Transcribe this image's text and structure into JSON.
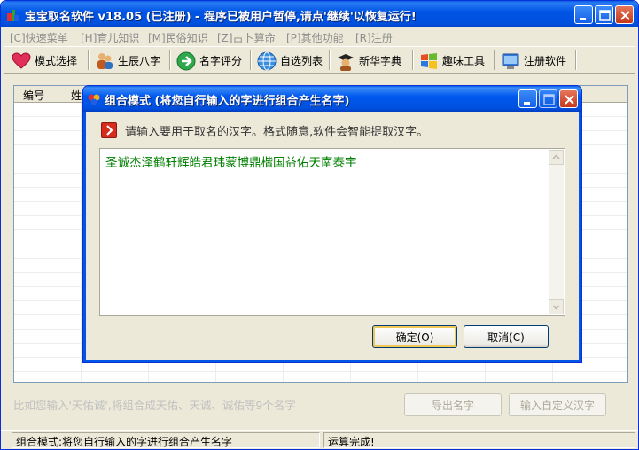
{
  "main_window": {
    "title": "宝宝取名软件 v18.05 (已注册) - 程序已被用户暂停,请点'继续'以恢复运行!"
  },
  "menu": [
    "[C]快速菜单",
    "[H]育儿知识",
    "[M]民俗知识",
    "[Z]占卜算命",
    "[P]其他功能",
    "[R]注册"
  ],
  "toolbar": [
    {
      "label": "模式选择",
      "icon": "heart-icon"
    },
    {
      "label": "生辰八字",
      "icon": "people-icon"
    },
    {
      "label": "名字评分",
      "icon": "arrow-right-icon"
    },
    {
      "label": "自选列表",
      "icon": "globe-icon"
    },
    {
      "label": "新华字典",
      "icon": "scholar-icon"
    },
    {
      "label": "趣味工具",
      "icon": "windows-icon"
    },
    {
      "label": "注册软件",
      "icon": "monitor-icon"
    }
  ],
  "grid": {
    "columns": [
      "编号",
      "姓"
    ]
  },
  "hint_text": "比如您输入'天佑诚',将组合成天佑、天诚、诚佑等9个名字",
  "bottom_buttons": {
    "export": "导出名字",
    "custom": "输入自定义汉字"
  },
  "status": {
    "left": "组合模式:将您自行输入的字进行组合产生名字",
    "right": "运算完成!"
  },
  "dialog": {
    "title": "组合模式 (将您自行输入的字进行组合产生名字)",
    "prompt": "请输入要用于取名的汉字。格式随意,软件会智能提取汉字。",
    "input_value": "圣诚杰泽鹤轩辉皓君玮蒙博鼎楷国益佑天南泰宇",
    "ok_label": "确定(O)",
    "cancel_label": "取消(C)"
  },
  "colors": {
    "titlebar": "#0055E5",
    "window_bg": "#ECE9D8",
    "input_text": "#008000",
    "prompt_icon": "#D62B1D"
  }
}
